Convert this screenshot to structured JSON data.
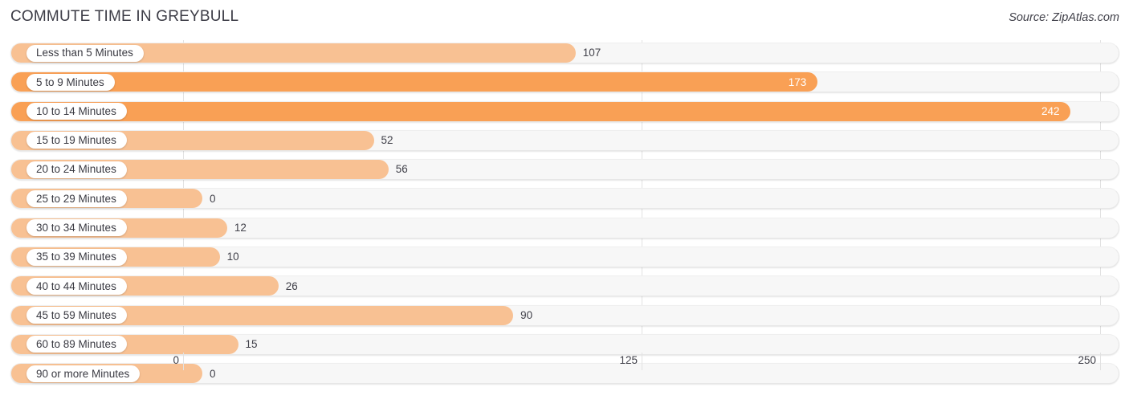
{
  "header": {
    "title": "COMMUTE TIME IN GREYBULL",
    "source": "Source: ZipAtlas.com"
  },
  "chart_data": {
    "type": "bar",
    "orientation": "horizontal",
    "title": "COMMUTE TIME IN GREYBULL",
    "xlabel": "",
    "ylabel": "",
    "xlim": [
      0,
      250
    ],
    "ticks": [
      "0",
      "125",
      "250"
    ],
    "tick_values": [
      0,
      125,
      250
    ],
    "grid": true,
    "legend": null,
    "categories": [
      "Less than 5 Minutes",
      "5 to 9 Minutes",
      "10 to 14 Minutes",
      "15 to 19 Minutes",
      "20 to 24 Minutes",
      "25 to 29 Minutes",
      "30 to 34 Minutes",
      "35 to 39 Minutes",
      "40 to 44 Minutes",
      "45 to 59 Minutes",
      "60 to 89 Minutes",
      "90 or more Minutes"
    ],
    "values": [
      107,
      173,
      242,
      52,
      56,
      0,
      12,
      10,
      26,
      90,
      15,
      0
    ],
    "value_labels": [
      "107",
      "173",
      "242",
      "52",
      "56",
      "0",
      "12",
      "10",
      "26",
      "90",
      "15",
      "0"
    ],
    "colors": {
      "bar": "#f8c193",
      "bar_highlight": "#f9a055",
      "track": "#f7f7f7",
      "grid": "#e2e2e2",
      "label_text": "#3a3a42",
      "value_text": "#41414a",
      "value_text_inside": "#ffffff"
    }
  }
}
